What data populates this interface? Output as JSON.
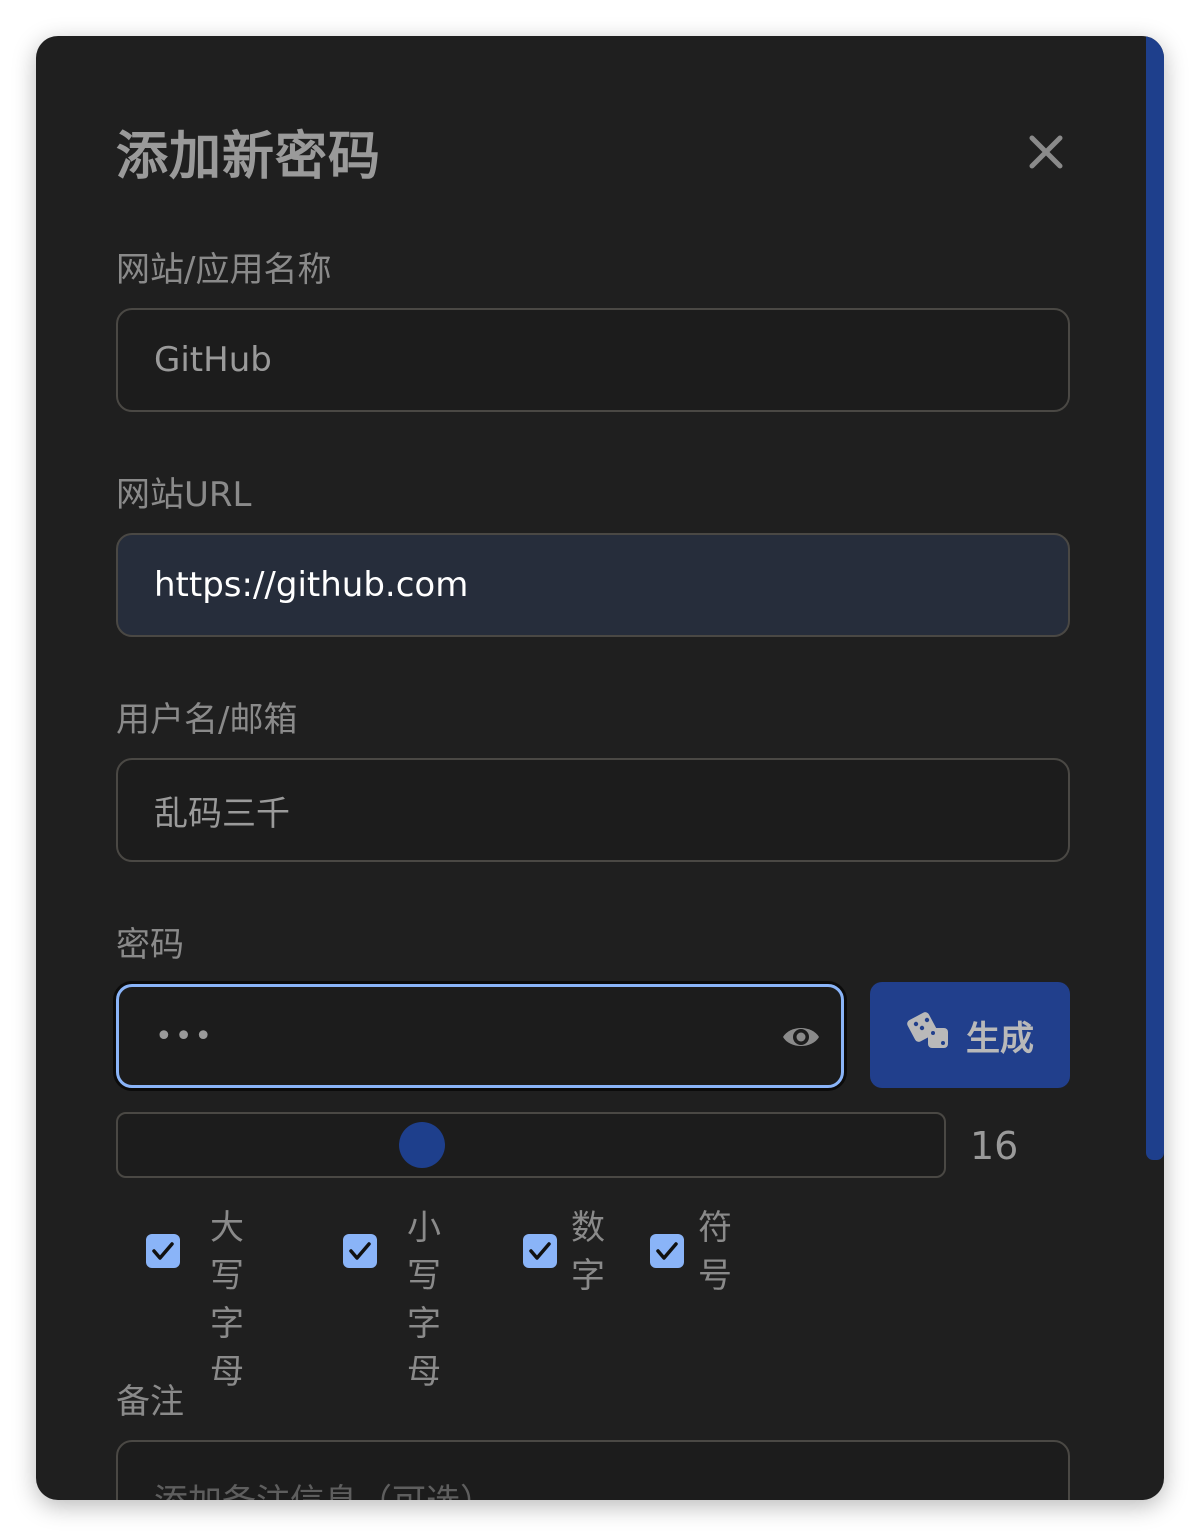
{
  "dialog": {
    "title": "添加新密码",
    "accent": "#1e3f8c",
    "focus_ring": "#8ab4f8"
  },
  "fields": {
    "site_name": {
      "label": "网站/应用名称",
      "value": "GitHub"
    },
    "url": {
      "label": "网站URL",
      "value": "https://github.com"
    },
    "username": {
      "label": "用户名/邮箱",
      "value": "乱码三千"
    },
    "password": {
      "label": "密码",
      "masked_value": "•••",
      "toggle_icon": "eye-icon"
    }
  },
  "generator": {
    "button_label": "生成",
    "button_icon": "dice-icon",
    "length": "16",
    "slider_fraction": 0.36,
    "options": [
      {
        "line1": "大写",
        "line2": "字母",
        "checked": true
      },
      {
        "line1": "小写",
        "line2": "字母",
        "checked": true
      },
      {
        "line1": "数",
        "line2": "字",
        "checked": true
      },
      {
        "line1": "符",
        "line2": "号",
        "checked": true
      }
    ]
  },
  "notes": {
    "label": "备注",
    "placeholder": "添加备注信息（可选）"
  }
}
